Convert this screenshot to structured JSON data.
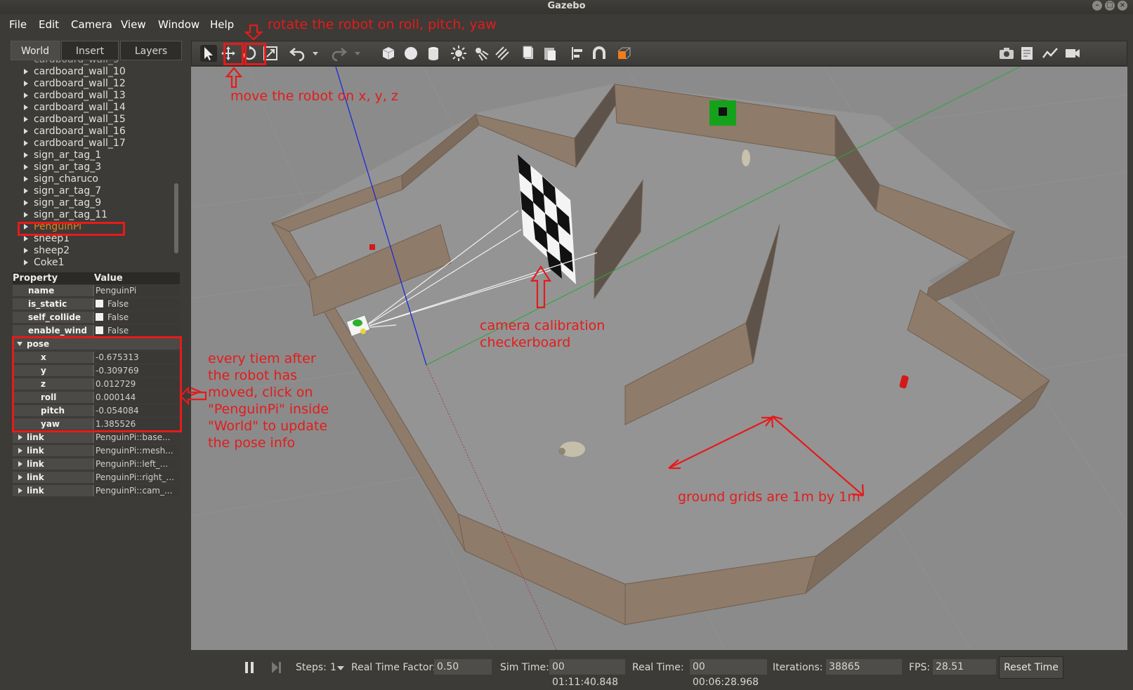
{
  "window": {
    "title": "Gazebo"
  },
  "menu": [
    "File",
    "Edit",
    "Camera",
    "View",
    "Window",
    "Help"
  ],
  "tabs": [
    "World",
    "Insert",
    "Layers"
  ],
  "tree": {
    "items": [
      "cardboard_wall_10",
      "cardboard_wall_12",
      "cardboard_wall_13",
      "cardboard_wall_14",
      "cardboard_wall_15",
      "cardboard_wall_16",
      "cardboard_wall_17",
      "sign_ar_tag_1",
      "sign_ar_tag_3",
      "sign_charuco",
      "sign_ar_tag_7",
      "sign_ar_tag_9",
      "sign_ar_tag_11",
      "PenguinPi",
      "sheep1",
      "sheep2",
      "Coke1"
    ],
    "selected": "PenguinPi"
  },
  "properties": {
    "header": {
      "property": "Property",
      "value": "Value"
    },
    "basic": [
      {
        "key": "name",
        "value": "PenguinPi",
        "check": false
      },
      {
        "key": "is_static",
        "value": "False",
        "check": true
      },
      {
        "key": "self_collide",
        "value": "False",
        "check": true
      },
      {
        "key": "enable_wind",
        "value": "False",
        "check": true
      }
    ],
    "pose_label": "pose",
    "pose": [
      {
        "key": "x",
        "value": "-0.675313"
      },
      {
        "key": "y",
        "value": "-0.309769"
      },
      {
        "key": "z",
        "value": "0.012729"
      },
      {
        "key": "roll",
        "value": "0.000144"
      },
      {
        "key": "pitch",
        "value": "-0.054084"
      },
      {
        "key": "yaw",
        "value": "1.385526"
      }
    ],
    "links": [
      {
        "key": "link",
        "value": "PenguinPi::base..."
      },
      {
        "key": "link",
        "value": "PenguinPi::mesh..."
      },
      {
        "key": "link",
        "value": "PenguinPi::left_..."
      },
      {
        "key": "link",
        "value": "PenguinPi::right_..."
      },
      {
        "key": "link",
        "value": "PenguinPi::cam_..."
      }
    ]
  },
  "bottom": {
    "steps_label": "Steps:",
    "steps_value": "1",
    "rtf_label": "Real Time Factor:",
    "rtf_value": "0.50",
    "sim_label": "Sim Time:",
    "sim_value": "00 01:11:40.848",
    "real_label": "Real Time:",
    "real_value": "00 00:06:28.968",
    "iter_label": "Iterations:",
    "iter_value": "38865",
    "fps_label": "FPS:",
    "fps_value": "28.51",
    "reset_label": "Reset Time"
  },
  "annotations": {
    "rotate": "rotate the robot on roll, pitch, yaw",
    "move": "move the robot on x, y, z",
    "camera": [
      "camera calibration",
      "checkerboard"
    ],
    "pose_note": [
      "every tiem after",
      "the robot has",
      "moved, click on",
      "\"PenguinPi\" inside",
      "\"World\" to update",
      "the pose info"
    ],
    "grid": "ground grids are 1m by 1m"
  },
  "colors": {
    "annotation": "#e51b1b",
    "selected_item": "#f07d1b",
    "wall": "#8f7b69",
    "floor": "#8b8b8b"
  }
}
